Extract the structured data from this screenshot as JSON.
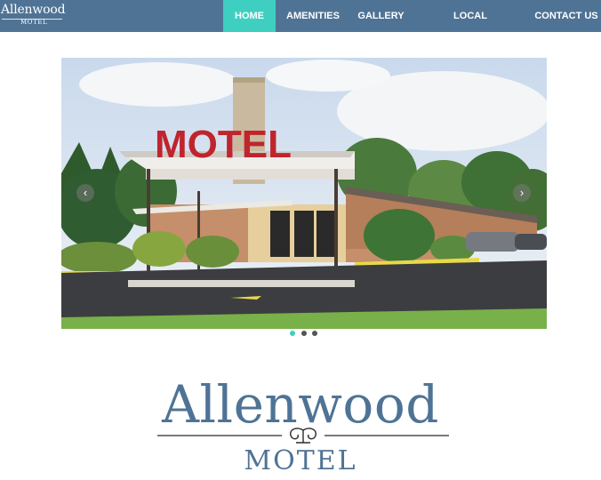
{
  "brand": {
    "name": "Allenwood",
    "sub": "MOTEL"
  },
  "nav": [
    {
      "label": "HOME",
      "active": true
    },
    {
      "label": "AMENITIES",
      "active": false
    },
    {
      "label": "GALLERY",
      "active": false
    },
    {
      "label": "LOCAL ATTRACTIONS",
      "active": false
    },
    {
      "label": "CONTACT US",
      "active": false
    }
  ],
  "slider": {
    "sign_text": "MOTEL",
    "prev_icon": "chevron-left-icon",
    "next_icon": "chevron-right-icon",
    "slide_count": 3,
    "active_slide": 1
  },
  "logo": {
    "title": "Allenwood",
    "sub": "MOTEL"
  },
  "colors": {
    "nav_bg": "#4f7395",
    "accent": "#3fcfc1",
    "brand_text": "#4f7395"
  }
}
